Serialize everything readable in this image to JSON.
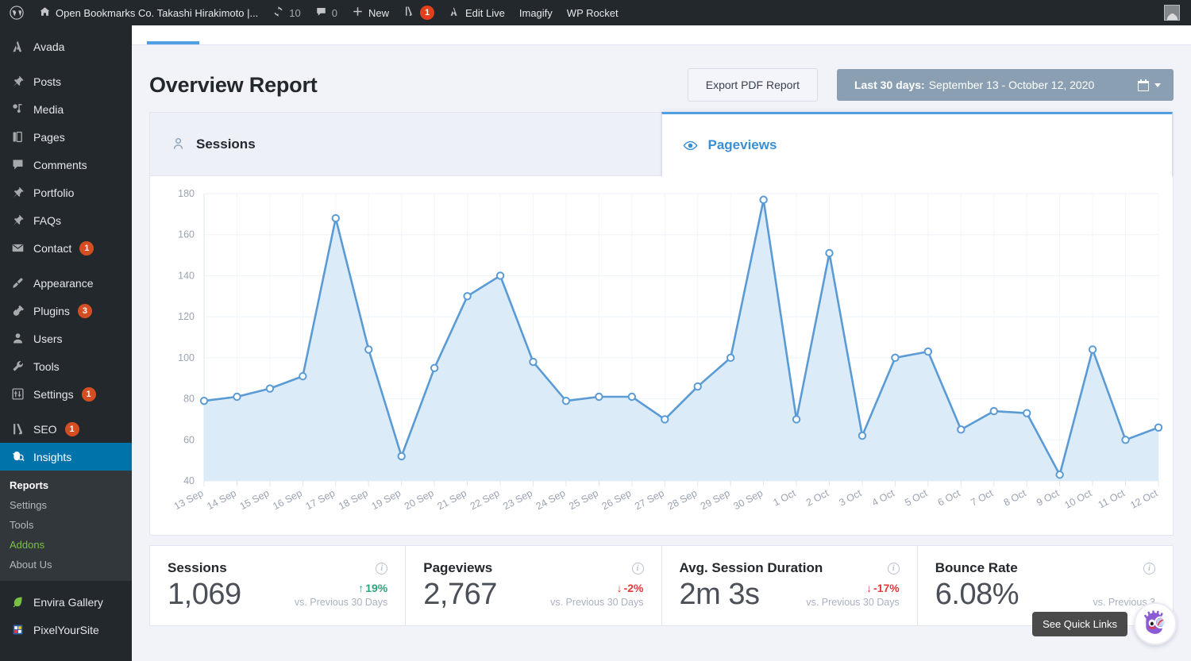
{
  "adminbar": {
    "logo_icon": "wordpress-logo-icon",
    "site_icon": "home-icon",
    "site_title": "Open Bookmarks Co. Takashi Hirakimoto |...",
    "updates_icon": "updates-icon",
    "updates_count": "10",
    "comments_icon": "comment-icon",
    "comments_count": "0",
    "new_icon": "plus-icon",
    "new_label": "New",
    "seo_icon": "yoast-icon",
    "seo_count": "1",
    "editlive_icon": "avada-icon",
    "editlive_label": "Edit Live",
    "imagify_label": "Imagify",
    "wprocket_label": "WP Rocket",
    "avatar_icon": "user-avatar-icon"
  },
  "sidebar": {
    "items": [
      {
        "label": "Avada",
        "icon": "avada-icon",
        "badge": ""
      },
      {
        "label": "Posts",
        "icon": "pin-icon",
        "badge": ""
      },
      {
        "label": "Media",
        "icon": "media-icon",
        "badge": ""
      },
      {
        "label": "Pages",
        "icon": "pages-icon",
        "badge": ""
      },
      {
        "label": "Comments",
        "icon": "comment-icon",
        "badge": ""
      },
      {
        "label": "Portfolio",
        "icon": "pin-icon",
        "badge": ""
      },
      {
        "label": "FAQs",
        "icon": "pin-icon",
        "badge": ""
      },
      {
        "label": "Contact",
        "icon": "envelope-icon",
        "badge": "1"
      },
      {
        "label": "Appearance",
        "icon": "brush-icon",
        "badge": ""
      },
      {
        "label": "Plugins",
        "icon": "plug-icon",
        "badge": "3"
      },
      {
        "label": "Users",
        "icon": "user-icon",
        "badge": ""
      },
      {
        "label": "Tools",
        "icon": "wrench-icon",
        "badge": ""
      },
      {
        "label": "Settings",
        "icon": "sliders-icon",
        "badge": "1"
      },
      {
        "label": "SEO",
        "icon": "yoast-icon",
        "badge": "1"
      },
      {
        "label": "Insights",
        "icon": "monsterinsights-icon",
        "badge": ""
      }
    ],
    "submenu": [
      {
        "label": "Reports",
        "state": "current"
      },
      {
        "label": "Settings",
        "state": ""
      },
      {
        "label": "Tools",
        "state": ""
      },
      {
        "label": "Addons",
        "state": "green"
      },
      {
        "label": "About Us",
        "state": ""
      }
    ],
    "footer_items": [
      {
        "label": "Envira Gallery",
        "icon": "leaf-icon"
      },
      {
        "label": "PixelYourSite",
        "icon": "pixel-icon"
      }
    ]
  },
  "header": {
    "title": "Overview Report",
    "export_label": "Export PDF Report",
    "daterange_prefix": "Last 30 days:",
    "daterange_value": "September 13 - October 12, 2020",
    "calendar_icon": "calendar-icon",
    "caret_icon": "chevron-down-icon"
  },
  "tabs": [
    {
      "label": "Sessions",
      "icon": "person-icon",
      "active": false
    },
    {
      "label": "Pageviews",
      "icon": "eye-icon",
      "active": true
    }
  ],
  "stats": [
    {
      "title": "Sessions",
      "value": "1,069",
      "delta": "19%",
      "direction": "up",
      "arrow": "↑",
      "note": "vs. Previous 30 Days",
      "info_icon": "info-icon"
    },
    {
      "title": "Pageviews",
      "value": "2,767",
      "delta": "-2%",
      "direction": "down",
      "arrow": "↓",
      "note": "vs. Previous 30 Days",
      "info_icon": "info-icon"
    },
    {
      "title": "Avg. Session Duration",
      "value": "2m 3s",
      "delta": "-17%",
      "direction": "down",
      "arrow": "↓",
      "note": "vs. Previous 30 Days",
      "info_icon": "info-icon"
    },
    {
      "title": "Bounce Rate",
      "value": "6.08%",
      "delta": "",
      "direction": "down",
      "arrow": "",
      "note": "vs. Previous 3",
      "info_icon": "info-icon"
    }
  ],
  "quicklinks": {
    "tooltip": "See Quick Links",
    "icon": "monsterinsights-mascot-icon"
  },
  "colors": {
    "accent_blue": "#509fe2",
    "line_blue": "#5b9bd5",
    "area_blue": "#dcebf8",
    "sidebar_bg": "#23282d",
    "submenu_bg": "#32373c",
    "current_menu": "#0073aa",
    "badge_orange": "#d54e21",
    "daterange_bg": "#8aa0b2",
    "up_green": "#2fa37a",
    "down_red": "#e8393b",
    "page_bg": "#f1f3f9",
    "addons_green": "#7ac143"
  },
  "chart_data": {
    "type": "area",
    "title": "Pageviews",
    "xlabel": "",
    "ylabel": "",
    "ylim": [
      40,
      180
    ],
    "yticks": [
      40,
      60,
      80,
      100,
      120,
      140,
      160,
      180
    ],
    "grid": true,
    "legend": "none",
    "categories": [
      "13 Sep",
      "14 Sep",
      "15 Sep",
      "16 Sep",
      "17 Sep",
      "18 Sep",
      "19 Sep",
      "20 Sep",
      "21 Sep",
      "22 Sep",
      "23 Sep",
      "24 Sep",
      "25 Sep",
      "26 Sep",
      "27 Sep",
      "28 Sep",
      "29 Sep",
      "30 Sep",
      "1 Oct",
      "2 Oct",
      "3 Oct",
      "4 Oct",
      "5 Oct",
      "6 Oct",
      "7 Oct",
      "8 Oct",
      "9 Oct",
      "10 Oct",
      "11 Oct",
      "12 Oct"
    ],
    "series": [
      {
        "name": "Pageviews",
        "values": [
          79,
          81,
          85,
          91,
          168,
          104,
          52,
          95,
          130,
          140,
          98,
          79,
          81,
          81,
          70,
          86,
          100,
          177,
          70,
          151,
          62,
          100,
          103,
          65,
          74,
          73,
          43,
          104,
          60,
          66
        ]
      }
    ]
  }
}
